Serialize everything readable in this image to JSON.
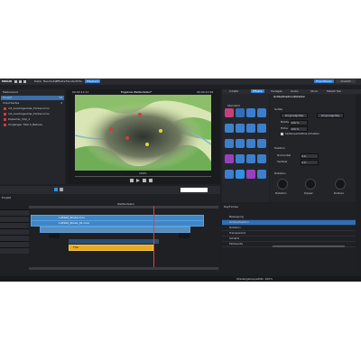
{
  "app": {
    "title": "Ergebnis Wetterdaten*",
    "logo": "MAGIX",
    "menu": [
      "Datei",
      "Bearbeiten",
      "Effekte",
      "Fenster",
      "Hilfe",
      "Playback"
    ],
    "right_buttons": [
      "Exportieren",
      "Ansicht"
    ]
  },
  "media_pool": {
    "title": "Medienpool",
    "items": [
      {
        "label": "Projekt",
        "count": "36"
      },
      {
        "label": "Importiertes",
        "count": "4"
      },
      {
        "label": "rot_Loadingsuhler_Farben.mov",
        "count": ""
      },
      {
        "label": "rot_Loadingsuhler_Farben.mov",
        "count": ""
      },
      {
        "label": "Kopierter_Clip_1",
        "count": ""
      },
      {
        "label": "Vorgänger Titel 4_Bebuss",
        "count": ""
      }
    ]
  },
  "preview": {
    "title": "Ergebnis Wetterdaten*",
    "timecode_left": "00:00:12:11",
    "timecode_right": "00:00:12:26",
    "zoom": "100%",
    "map_colors": {
      "land": "#d9e5b4",
      "forest": "#6fae56",
      "river": "#7fb6d6",
      "center": "#3a3f38"
    }
  },
  "effects": {
    "tabs": [
      "Inhalte",
      "Effekte",
      "Vorlagen",
      "Audio",
      "Store",
      "MAGIX Tab"
    ],
    "category_label": "Standard",
    "tiles": [
      {
        "name": "text-tile",
        "color": "#c4417b"
      },
      {
        "name": "color-tile",
        "color": "#2f6fb7"
      },
      {
        "name": "brightness-tile",
        "color": "#3a7fcf"
      },
      {
        "name": "camera-tile",
        "color": "#3b7fce"
      },
      {
        "name": "pan-tile",
        "color": "#3d83cc"
      },
      {
        "name": "size-tile",
        "color": "#3b7fce"
      },
      {
        "name": "speed-tile",
        "color": "#3b7fce"
      },
      {
        "name": "mask-tile",
        "color": "#3b7fce"
      },
      {
        "name": "stabilize-tile",
        "color": "#3b7fce"
      },
      {
        "name": "time-tile",
        "color": "#3b7fce"
      },
      {
        "name": "film-tile",
        "color": "#3b7fce"
      },
      {
        "name": "blur-tile",
        "color": "#3b7fce"
      },
      {
        "name": "paint-tile",
        "color": "#9a3fc0"
      },
      {
        "name": "frame-tile",
        "color": "#3b7fce"
      },
      {
        "name": "mirror-tile",
        "color": "#3b7fce"
      },
      {
        "name": "light-tile",
        "color": "#3b7fce"
      },
      {
        "name": "transition-tile",
        "color": "#3b7fce"
      },
      {
        "name": "select-tile",
        "color": "#2f90e6"
      },
      {
        "name": "magic-tile",
        "color": "#9a3fc0"
      },
      {
        "name": "extra-tile",
        "color": "#3b7fce"
      }
    ]
  },
  "properties": {
    "title": "Größe/Position/Rotation",
    "section_position": "Größe",
    "btn_left": "Originalgröße",
    "btn_right": "Originalgröße",
    "fields": [
      {
        "label": "Breite",
        "value": "100 %"
      },
      {
        "label": "Höhe",
        "value": "100 %"
      }
    ],
    "checkbox_label": "Seitenverhältnis erhalten",
    "section_2": "Position",
    "fields_2": [
      {
        "label": "Horizontal",
        "value": "0,0"
      },
      {
        "label": "Vertikal",
        "value": "0,0"
      }
    ],
    "section_3": "Rotation",
    "dials": [
      "Rotation",
      "Kippen",
      "Drehen"
    ]
  },
  "timeline": {
    "label": "Projekt",
    "sequence_name": "Wetterdaten",
    "tracks": 7,
    "clips_blue": [
      "Luftbild_Route.mov",
      "Luftbild_Route_01.mov"
    ],
    "clip_gold": "Titel"
  },
  "keyframes": {
    "header": "Keyframes",
    "rows": [
      "Bewegung",
      "Größe/Position",
      "Rotation",
      "Transparenz",
      "Schärfe",
      "Farbwerte"
    ]
  },
  "status": {
    "left": "",
    "right": "Wiedergabequalität: 100%"
  }
}
